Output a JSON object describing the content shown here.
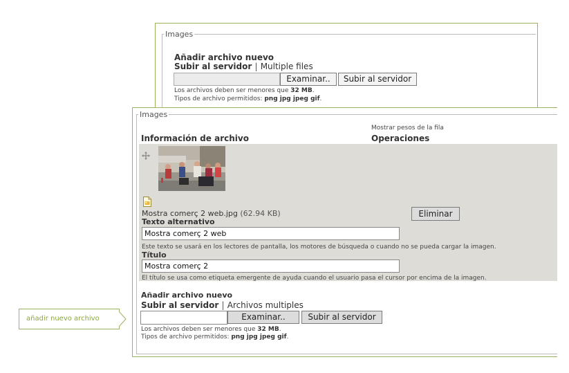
{
  "back_panel": {
    "legend": "Images",
    "add_title": "Añadir archivo nuevo",
    "upload_link": "Subir al servidor",
    "separator": "|",
    "alt_link": "Multiple files",
    "browse_button": "Examinar..",
    "upload_button": "Subir al servidor",
    "size_note_prefix": "Los archivos deben ser menores que ",
    "size_value": "32 MB",
    "size_note_suffix": ".",
    "types_prefix": "Tipos de archivo permitidos: ",
    "types_value": "png jpg jpeg gif",
    "types_suffix": "."
  },
  "front_panel": {
    "legend": "Images",
    "col_file_info": "Información de archivo",
    "show_weights": "Mostrar pesos de la fila",
    "col_operations": "Operaciones",
    "drag_icon": "move-cross-icon",
    "file_icon": "file-image-icon",
    "file_name": "Mostra comerç 2 web.jpg",
    "file_size": "(62.94 KB)",
    "remove_button": "Eliminar",
    "alt_label": "Texto alternativo",
    "alt_value": "Mostra comerç 2 web",
    "alt_help": "Este texto se usará en los lectores de pantalla, los motores de búsqueda o cuando no se pueda cargar la imagen.",
    "title_label": "Título",
    "title_value": "Mostra comerç 2",
    "title_help": "El título se usa como etiqueta emergente de ayuda cuando el usuario pasa el cursor por encima de la imagen.",
    "add_title": "Añadir archivo nuevo",
    "upload_link": "Subir al servidor",
    "separator": "|",
    "alt_link": "Archivos multiples",
    "browse_button": "Examinar..",
    "upload_button": "Subir al servidor",
    "size_note_prefix": "Los archivos deben ser menores que ",
    "size_value": "32 MB",
    "size_note_suffix": ".",
    "types_prefix": "Tipos de archivo permitidos: ",
    "types_value": "png jpg jpeg gif",
    "types_suffix": "."
  },
  "callout": {
    "text": "añadir nuevo archivo"
  },
  "colors": {
    "accent_green": "#9cb35d",
    "row_grey": "#dddcd7"
  }
}
